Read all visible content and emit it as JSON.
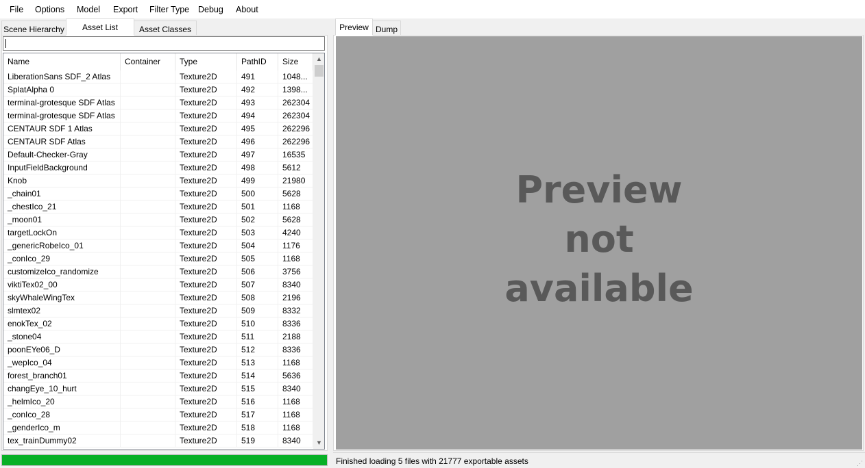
{
  "menu": [
    "File",
    "Options",
    "Model",
    "Export",
    "Filter Type",
    "Debug",
    "About"
  ],
  "left_tabs": [
    "Scene Hierarchy",
    "Asset List",
    "Asset Classes"
  ],
  "active_left_tab": "Asset List",
  "search": {
    "value": ""
  },
  "columns": [
    "Name",
    "Container",
    "Type",
    "PathID",
    "Size"
  ],
  "rows": [
    [
      "LiberationSans SDF_2 Atlas",
      "",
      "Texture2D",
      "491",
      "1048..."
    ],
    [
      "SplatAlpha 0",
      "",
      "Texture2D",
      "492",
      "1398..."
    ],
    [
      "terminal-grotesque SDF Atlas",
      "",
      "Texture2D",
      "493",
      "262304"
    ],
    [
      "terminal-grotesque SDF Atlas",
      "",
      "Texture2D",
      "494",
      "262304"
    ],
    [
      "CENTAUR SDF 1 Atlas",
      "",
      "Texture2D",
      "495",
      "262296"
    ],
    [
      "CENTAUR SDF Atlas",
      "",
      "Texture2D",
      "496",
      "262296"
    ],
    [
      "Default-Checker-Gray",
      "",
      "Texture2D",
      "497",
      "16535"
    ],
    [
      "InputFieldBackground",
      "",
      "Texture2D",
      "498",
      "5612"
    ],
    [
      "Knob",
      "",
      "Texture2D",
      "499",
      "21980"
    ],
    [
      "_chain01",
      "",
      "Texture2D",
      "500",
      "5628"
    ],
    [
      "_chestIco_21",
      "",
      "Texture2D",
      "501",
      "1168"
    ],
    [
      "_moon01",
      "",
      "Texture2D",
      "502",
      "5628"
    ],
    [
      "targetLockOn",
      "",
      "Texture2D",
      "503",
      "4240"
    ],
    [
      "_genericRobeIco_01",
      "",
      "Texture2D",
      "504",
      "1176"
    ],
    [
      "_conIco_29",
      "",
      "Texture2D",
      "505",
      "1168"
    ],
    [
      "customizeIco_randomize",
      "",
      "Texture2D",
      "506",
      "3756"
    ],
    [
      "viktiTex02_00",
      "",
      "Texture2D",
      "507",
      "8340"
    ],
    [
      "skyWhaleWingTex",
      "",
      "Texture2D",
      "508",
      "2196"
    ],
    [
      "slmtex02",
      "",
      "Texture2D",
      "509",
      "8332"
    ],
    [
      "enokTex_02",
      "",
      "Texture2D",
      "510",
      "8336"
    ],
    [
      "_stone04",
      "",
      "Texture2D",
      "511",
      "2188"
    ],
    [
      "poonEYe06_D",
      "",
      "Texture2D",
      "512",
      "8336"
    ],
    [
      "_wepIco_04",
      "",
      "Texture2D",
      "513",
      "1168"
    ],
    [
      "forest_branch01",
      "",
      "Texture2D",
      "514",
      "5636"
    ],
    [
      "changEye_10_hurt",
      "",
      "Texture2D",
      "515",
      "8340"
    ],
    [
      "_helmIco_20",
      "",
      "Texture2D",
      "516",
      "1168"
    ],
    [
      "_conIco_28",
      "",
      "Texture2D",
      "517",
      "1168"
    ],
    [
      "_genderIco_m",
      "",
      "Texture2D",
      "518",
      "1168"
    ],
    [
      "tex_trainDummy02",
      "",
      "Texture2D",
      "519",
      "8340"
    ]
  ],
  "right_tabs": [
    "Preview",
    "Dump"
  ],
  "active_right_tab": "Preview",
  "preview_text": [
    "Preview",
    "not",
    "available"
  ],
  "status": "Finished loading 5 files with 21777 exportable assets",
  "progress": 1.0,
  "icons": {
    "scroll_up": "scroll-up-arrow-icon",
    "scroll_down": "scroll-down-arrow-icon",
    "grip": "resize-grip-icon"
  },
  "colors": {
    "progress": "#06b025",
    "preview_bg": "#a0a0a0",
    "preview_text": "#595959"
  }
}
